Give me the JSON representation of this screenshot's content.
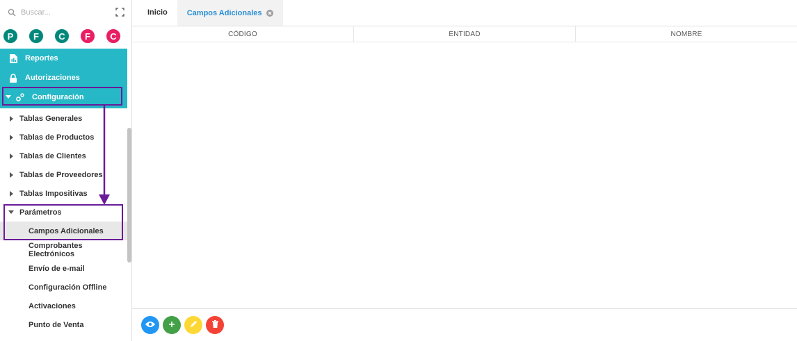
{
  "sidebar": {
    "search_placeholder": "Buscar...",
    "avatars": [
      "P",
      "F",
      "C",
      "F",
      "C"
    ],
    "teal_items": {
      "reportes": "Reportes",
      "autorizaciones": "Autorizaciones",
      "configuracion": "Configuración"
    },
    "menu": {
      "tablas_generales": "Tablas Generales",
      "tablas_productos": "Tablas de Productos",
      "tablas_clientes": "Tablas de Clientes",
      "tablas_proveedores": "Tablas de Proveedores",
      "tablas_impositivas": "Tablas Impositivas",
      "parametros": "Parámetros"
    },
    "sub_items": {
      "campos_adicionales": "Campos Adicionales",
      "comprobantes": "Comprobantes Electrónicos",
      "envio_email": "Envío de e-mail",
      "config_offline": "Configuración Offline",
      "activaciones": "Activaciones",
      "punto_venta": "Punto de Venta"
    }
  },
  "tabs": {
    "inicio": "Inicio",
    "campos_adicionales": "Campos Adicionales"
  },
  "table": {
    "columns": [
      "CÓDIGO",
      "ENTIDAD",
      "NOMBRE"
    ]
  },
  "colors": {
    "sidebar_accent": "#26b8c6",
    "annotation": "#6a1b9a",
    "active_tab_text": "#2a8fd6",
    "view": "#2196f3",
    "add": "#43a047",
    "edit": "#fdd835",
    "delete": "#f44336"
  },
  "icons": {
    "search": "search-icon",
    "expand": "expand-icon",
    "reportes": "document-icon",
    "autorizaciones": "lock-icon",
    "configuracion": "gears-icon",
    "close_tab": "close-icon",
    "view": "eye-icon",
    "add": "plus-icon",
    "edit": "pencil-icon",
    "delete": "trash-icon"
  }
}
